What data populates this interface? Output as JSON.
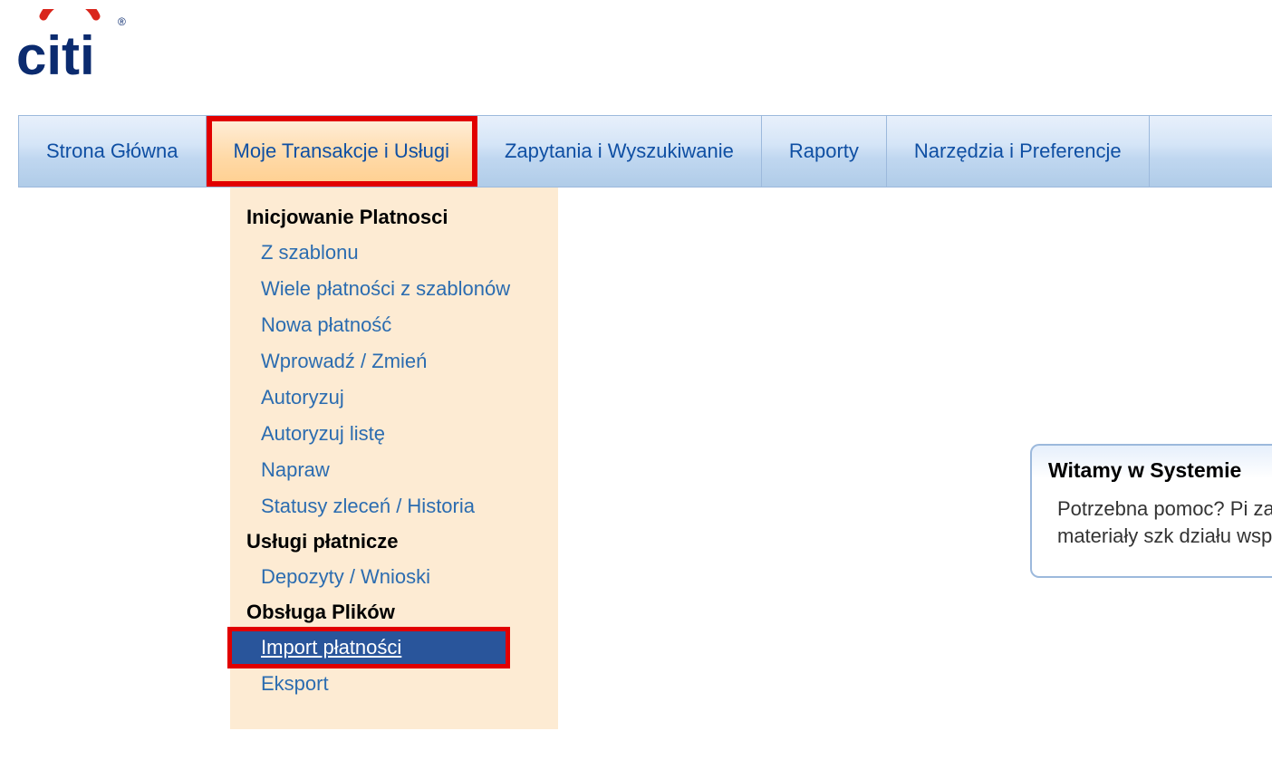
{
  "logo": {
    "name": "citi-logo"
  },
  "nav": {
    "items": [
      {
        "label": "Strona Główna",
        "active": false
      },
      {
        "label": "Moje Transakcje i Usługi",
        "active": true
      },
      {
        "label": "Zapytania i Wyszukiwanie",
        "active": false
      },
      {
        "label": "Raporty",
        "active": false
      },
      {
        "label": "Narzędzia i Preferencje",
        "active": false
      }
    ]
  },
  "dropdown": {
    "sections": [
      {
        "heading": "Inicjowanie Platnosci",
        "items": [
          {
            "label": "Z szablonu",
            "selected": false
          },
          {
            "label": "Wiele płatności z szablonów",
            "selected": false
          },
          {
            "label": "Nowa płatność",
            "selected": false
          },
          {
            "label": "Wprowadź / Zmień",
            "selected": false
          },
          {
            "label": "Autoryzuj",
            "selected": false
          },
          {
            "label": "Autoryzuj listę",
            "selected": false
          },
          {
            "label": "Napraw",
            "selected": false
          },
          {
            "label": "Statusy zleceń / Historia",
            "selected": false
          }
        ]
      },
      {
        "heading": "Usługi płatnicze",
        "items": [
          {
            "label": "Depozyty / Wnioski",
            "selected": false
          }
        ]
      },
      {
        "heading": "Obsługa Plików",
        "items": [
          {
            "label": "Import płatności",
            "selected": true
          },
          {
            "label": "Eksport",
            "selected": false
          }
        ]
      }
    ]
  },
  "welcome": {
    "title": "Witamy w Systemie",
    "text": "Potrzebna pomoc? Pi zawiera materiały szk działu wsparcia."
  }
}
